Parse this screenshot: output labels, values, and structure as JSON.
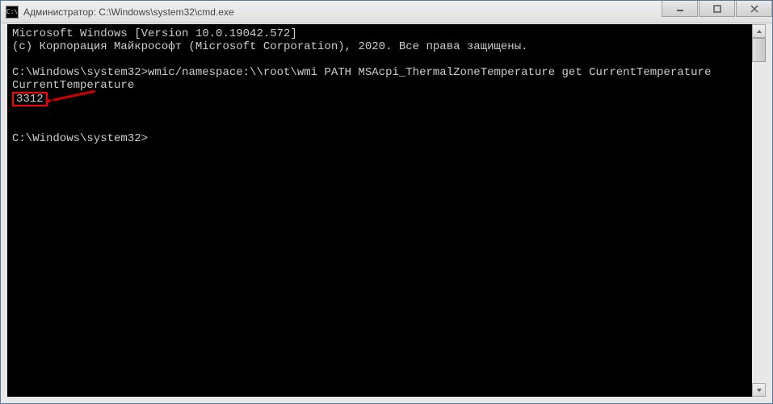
{
  "titlebar": {
    "icon_label": "C:\\",
    "title": "Администратор: C:\\Windows\\system32\\cmd.exe"
  },
  "console": {
    "line1": "Microsoft Windows [Version 10.0.19042.572]",
    "line2": "(c) Корпорация Майкрософт (Microsoft Corporation), 2020. Все права защищены.",
    "blank1": "",
    "prompt1_path": "C:\\Windows\\system32>",
    "prompt1_cmd": "wmic/namespace:\\\\root\\wmi PATH MSAcpi_ThermalZoneTemperature get CurrentTemperature",
    "result_header": "CurrentTemperature",
    "result_value": "3312",
    "blank2": "",
    "blank3": "",
    "prompt2_path": "C:\\Windows\\system32>"
  },
  "colors": {
    "highlight": "#ff0000",
    "arrow": "#cc0000"
  }
}
